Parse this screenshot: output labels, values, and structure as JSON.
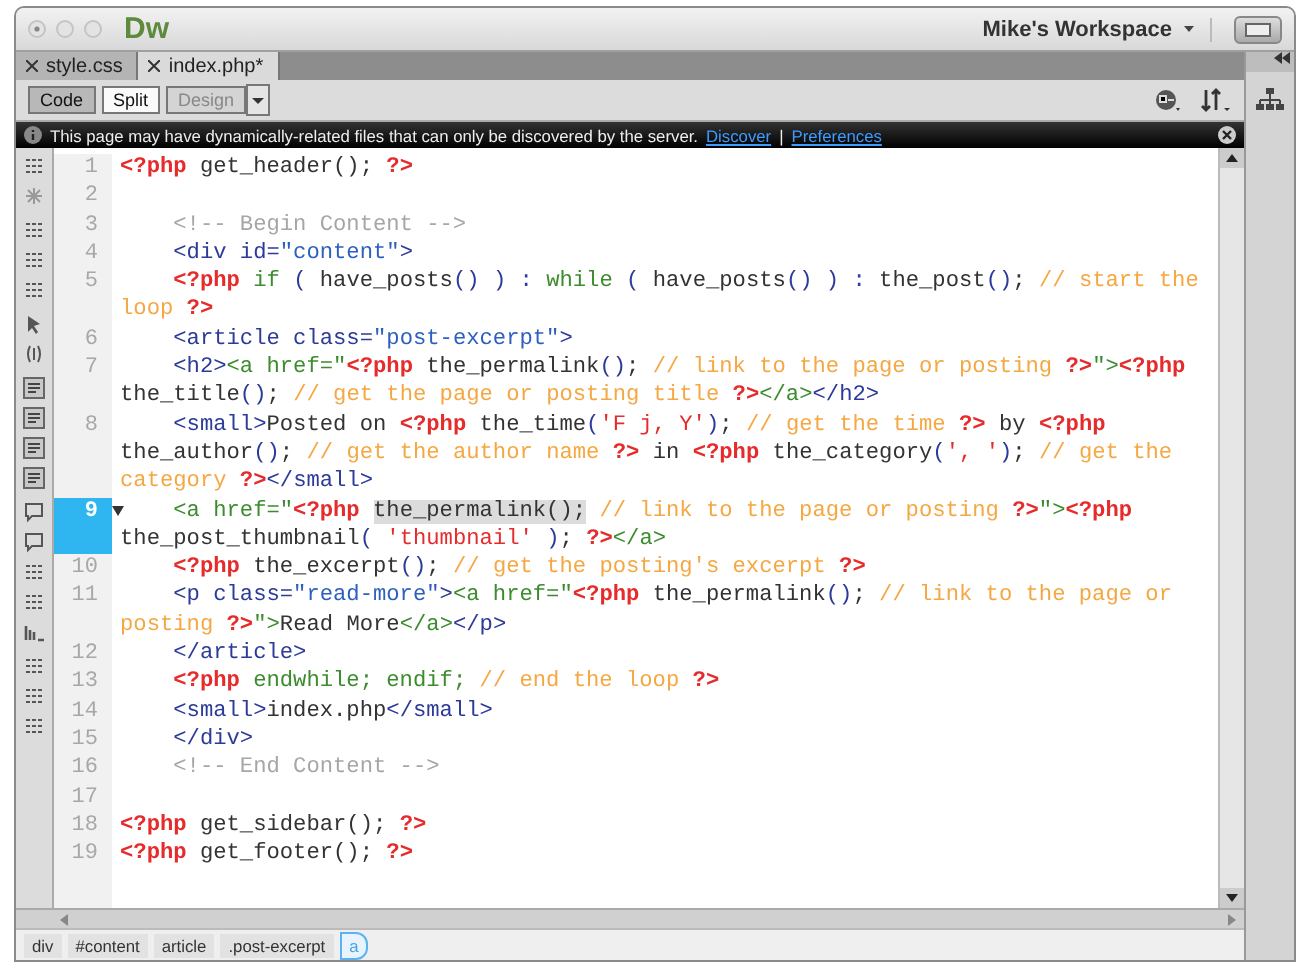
{
  "window": {
    "logo": "Dw",
    "workspace": "Mike's Workspace"
  },
  "tabs": [
    {
      "label": "style.css",
      "selected": false
    },
    {
      "label": "index.php*",
      "selected": true
    }
  ],
  "view_buttons": [
    {
      "label": "Code",
      "selected": true,
      "disabled": false
    },
    {
      "label": "Split",
      "selected": false,
      "disabled": false
    },
    {
      "label": "Design",
      "selected": false,
      "disabled": true
    }
  ],
  "info_bar": {
    "message": "This page may have dynamically-related files that can only be discovered by the server.",
    "links": [
      "Discover",
      "Preferences"
    ],
    "separator": "|"
  },
  "editor": {
    "lines": [
      {
        "number": "1",
        "selected": false,
        "wrapped_rows": [
          {
            "tokens": [
              {
                "kind": "php",
                "text": "<?php"
              },
              {
                "kind": "text",
                "text": " get_header(); "
              },
              {
                "kind": "php",
                "text": "?>"
              }
            ]
          }
        ]
      },
      {
        "number": "2",
        "selected": false
      },
      {
        "number": "3",
        "selected": false,
        "wrapped_rows": [
          {
            "tokens": [
              {
                "kind": "htmlcomment",
                "text": "    <!-- Begin Content -->"
              }
            ]
          }
        ]
      },
      {
        "number": "4",
        "selected": false,
        "wrapped_rows": [
          {
            "tokens": [
              {
                "kind": "tag",
                "text": "    <div id="
              },
              {
                "kind": "string",
                "text": "\"content\""
              },
              {
                "kind": "tag",
                "text": ">"
              }
            ]
          }
        ]
      },
      {
        "number": "5",
        "selected": false,
        "wrapped_rows": [
          {
            "tokens": [
              {
                "kind": "php",
                "text": "    <?php"
              },
              {
                "kind": "keyword",
                "text": " if "
              },
              {
                "kind": "punct",
                "text": "( "
              },
              {
                "kind": "text",
                "text": "have_posts"
              },
              {
                "kind": "punct",
                "text": "() ) : "
              },
              {
                "kind": "keyword",
                "text": "while"
              },
              {
                "kind": "punct",
                "text": " ( "
              },
              {
                "kind": "text",
                "text": "have_posts"
              },
              {
                "kind": "punct",
                "text": "() ) : "
              },
              {
                "kind": "text",
                "text": "the_post"
              },
              {
                "kind": "punct",
                "text": "()"
              },
              {
                "kind": "text",
                "text": "; "
              },
              {
                "kind": "comment",
                "text": "// start the"
              }
            ]
          },
          {
            "tokens": [
              {
                "kind": "comment",
                "text": "loop "
              },
              {
                "kind": "php",
                "text": "?>"
              }
            ]
          }
        ]
      },
      {
        "number": "6",
        "selected": false,
        "wrapped_rows": [
          {
            "tokens": [
              {
                "kind": "tag",
                "text": "    <article class="
              },
              {
                "kind": "string",
                "text": "\"post-excerpt\""
              },
              {
                "kind": "tag",
                "text": ">"
              }
            ]
          }
        ]
      },
      {
        "number": "7",
        "selected": false,
        "wrapped_rows": [
          {
            "tokens": [
              {
                "kind": "tag",
                "text": "    <h2>"
              },
              {
                "kind": "anchor",
                "text": "<a href=\""
              },
              {
                "kind": "php",
                "text": "<?php"
              },
              {
                "kind": "text",
                "text": " the_permalink"
              },
              {
                "kind": "punct",
                "text": "()"
              },
              {
                "kind": "text",
                "text": "; "
              },
              {
                "kind": "comment",
                "text": "// link to the page or posting "
              },
              {
                "kind": "php",
                "text": "?>"
              },
              {
                "kind": "anchor",
                "text": "\">"
              },
              {
                "kind": "php",
                "text": "<?php"
              }
            ]
          },
          {
            "tokens": [
              {
                "kind": "text",
                "text": "the_title"
              },
              {
                "kind": "punct",
                "text": "()"
              },
              {
                "kind": "text",
                "text": "; "
              },
              {
                "kind": "comment",
                "text": "// get the page or posting title "
              },
              {
                "kind": "php",
                "text": "?>"
              },
              {
                "kind": "anchor",
                "text": "</a>"
              },
              {
                "kind": "tag",
                "text": "</h2>"
              }
            ]
          }
        ]
      },
      {
        "number": "8",
        "selected": false,
        "wrapped_rows": [
          {
            "tokens": [
              {
                "kind": "tag",
                "text": "    <small>"
              },
              {
                "kind": "text",
                "text": "Posted on "
              },
              {
                "kind": "php",
                "text": "<?php"
              },
              {
                "kind": "text",
                "text": " the_time"
              },
              {
                "kind": "punct",
                "text": "("
              },
              {
                "kind": "phpstring",
                "text": "'F j, Y'"
              },
              {
                "kind": "punct",
                "text": ")"
              },
              {
                "kind": "text",
                "text": "; "
              },
              {
                "kind": "comment",
                "text": "// get the time "
              },
              {
                "kind": "php",
                "text": "?>"
              },
              {
                "kind": "text",
                "text": " by "
              },
              {
                "kind": "php",
                "text": "<?php"
              }
            ]
          },
          {
            "tokens": [
              {
                "kind": "text",
                "text": "the_author"
              },
              {
                "kind": "punct",
                "text": "()"
              },
              {
                "kind": "text",
                "text": "; "
              },
              {
                "kind": "comment",
                "text": "// get the author name "
              },
              {
                "kind": "php",
                "text": "?>"
              },
              {
                "kind": "text",
                "text": " in "
              },
              {
                "kind": "php",
                "text": "<?php"
              },
              {
                "kind": "text",
                "text": " the_category"
              },
              {
                "kind": "punct",
                "text": "("
              },
              {
                "kind": "phpstring",
                "text": "', '"
              },
              {
                "kind": "punct",
                "text": ")"
              },
              {
                "kind": "text",
                "text": "; "
              },
              {
                "kind": "comment",
                "text": "// get the"
              }
            ]
          },
          {
            "tokens": [
              {
                "kind": "comment",
                "text": "category "
              },
              {
                "kind": "php",
                "text": "?>"
              },
              {
                "kind": "tag",
                "text": "</small>"
              }
            ]
          }
        ]
      },
      {
        "number": "9",
        "selected": true,
        "wrapped_rows": [
          {
            "tokens": [
              {
                "kind": "anchor",
                "text": "    <a href=\""
              },
              {
                "kind": "php",
                "text": "<?php "
              },
              {
                "kind": "highlight",
                "text": "the_permalink();"
              },
              {
                "kind": "comment",
                "text": " // link to the page or posting "
              },
              {
                "kind": "php",
                "text": "?>"
              },
              {
                "kind": "anchor",
                "text": "\">"
              },
              {
                "kind": "php",
                "text": "<?php"
              }
            ]
          },
          {
            "tokens": [
              {
                "kind": "text",
                "text": "the_post_thumbnail"
              },
              {
                "kind": "punct",
                "text": "( "
              },
              {
                "kind": "phpstring",
                "text": "'thumbnail'"
              },
              {
                "kind": "punct",
                "text": " )"
              },
              {
                "kind": "text",
                "text": "; "
              },
              {
                "kind": "php",
                "text": "?>"
              },
              {
                "kind": "anchor",
                "text": "</a>"
              }
            ]
          }
        ]
      },
      {
        "number": "10",
        "selected": false,
        "wrapped_rows": [
          {
            "tokens": [
              {
                "kind": "php",
                "text": "    <?php"
              },
              {
                "kind": "text",
                "text": " the_excerpt"
              },
              {
                "kind": "punct",
                "text": "()"
              },
              {
                "kind": "text",
                "text": "; "
              },
              {
                "kind": "comment",
                "text": "// get the posting's excerpt "
              },
              {
                "kind": "php",
                "text": "?>"
              }
            ]
          }
        ]
      },
      {
        "number": "11",
        "selected": false,
        "wrapped_rows": [
          {
            "tokens": [
              {
                "kind": "tag",
                "text": "    <p class="
              },
              {
                "kind": "string",
                "text": "\"read-more\""
              },
              {
                "kind": "tag",
                "text": ">"
              },
              {
                "kind": "anchor",
                "text": "<a href=\""
              },
              {
                "kind": "php",
                "text": "<?php"
              },
              {
                "kind": "text",
                "text": " the_permalink"
              },
              {
                "kind": "punct",
                "text": "()"
              },
              {
                "kind": "text",
                "text": "; "
              },
              {
                "kind": "comment",
                "text": "// link to the page or"
              }
            ]
          },
          {
            "tokens": [
              {
                "kind": "comment",
                "text": "posting "
              },
              {
                "kind": "php",
                "text": "?>"
              },
              {
                "kind": "anchor",
                "text": "\">"
              },
              {
                "kind": "text",
                "text": "Read More"
              },
              {
                "kind": "anchor",
                "text": "</a>"
              },
              {
                "kind": "tag",
                "text": "</p>"
              }
            ]
          }
        ]
      },
      {
        "number": "12",
        "selected": false,
        "wrapped_rows": [
          {
            "tokens": [
              {
                "kind": "tag",
                "text": "    </article>"
              }
            ]
          }
        ]
      },
      {
        "number": "13",
        "selected": false,
        "wrapped_rows": [
          {
            "tokens": [
              {
                "kind": "php",
                "text": "    <?php"
              },
              {
                "kind": "keyword",
                "text": " endwhile; endif; "
              },
              {
                "kind": "comment",
                "text": "// end the loop "
              },
              {
                "kind": "php",
                "text": "?>"
              }
            ]
          }
        ]
      },
      {
        "number": "14",
        "selected": false,
        "wrapped_rows": [
          {
            "tokens": [
              {
                "kind": "tag",
                "text": "    <small>"
              },
              {
                "kind": "text",
                "text": "index.php"
              },
              {
                "kind": "tag",
                "text": "</small>"
              }
            ]
          }
        ]
      },
      {
        "number": "15",
        "selected": false,
        "wrapped_rows": [
          {
            "tokens": [
              {
                "kind": "tag",
                "text": "    </div>"
              }
            ]
          }
        ]
      },
      {
        "number": "16",
        "selected": false,
        "wrapped_rows": [
          {
            "tokens": [
              {
                "kind": "htmlcomment",
                "text": "    <!-- End Content -->"
              }
            ]
          }
        ]
      },
      {
        "number": "17",
        "selected": false
      },
      {
        "number": "18",
        "selected": false,
        "wrapped_rows": [
          {
            "tokens": [
              {
                "kind": "php",
                "text": "<?php"
              },
              {
                "kind": "text",
                "text": " get_sidebar(); "
              },
              {
                "kind": "php",
                "text": "?>"
              }
            ]
          }
        ]
      },
      {
        "number": "19",
        "selected": false,
        "wrapped_rows": [
          {
            "tokens": [
              {
                "kind": "php",
                "text": "<?php"
              },
              {
                "kind": "text",
                "text": " get_footer(); "
              },
              {
                "kind": "php",
                "text": "?>"
              }
            ]
          }
        ]
      }
    ]
  },
  "tag_selector": [
    {
      "label": "div",
      "selected": false
    },
    {
      "label": "#content",
      "selected": false
    },
    {
      "label": "article",
      "selected": false
    },
    {
      "label": ".post-excerpt",
      "selected": false
    },
    {
      "label": "a",
      "selected": true
    }
  ]
}
